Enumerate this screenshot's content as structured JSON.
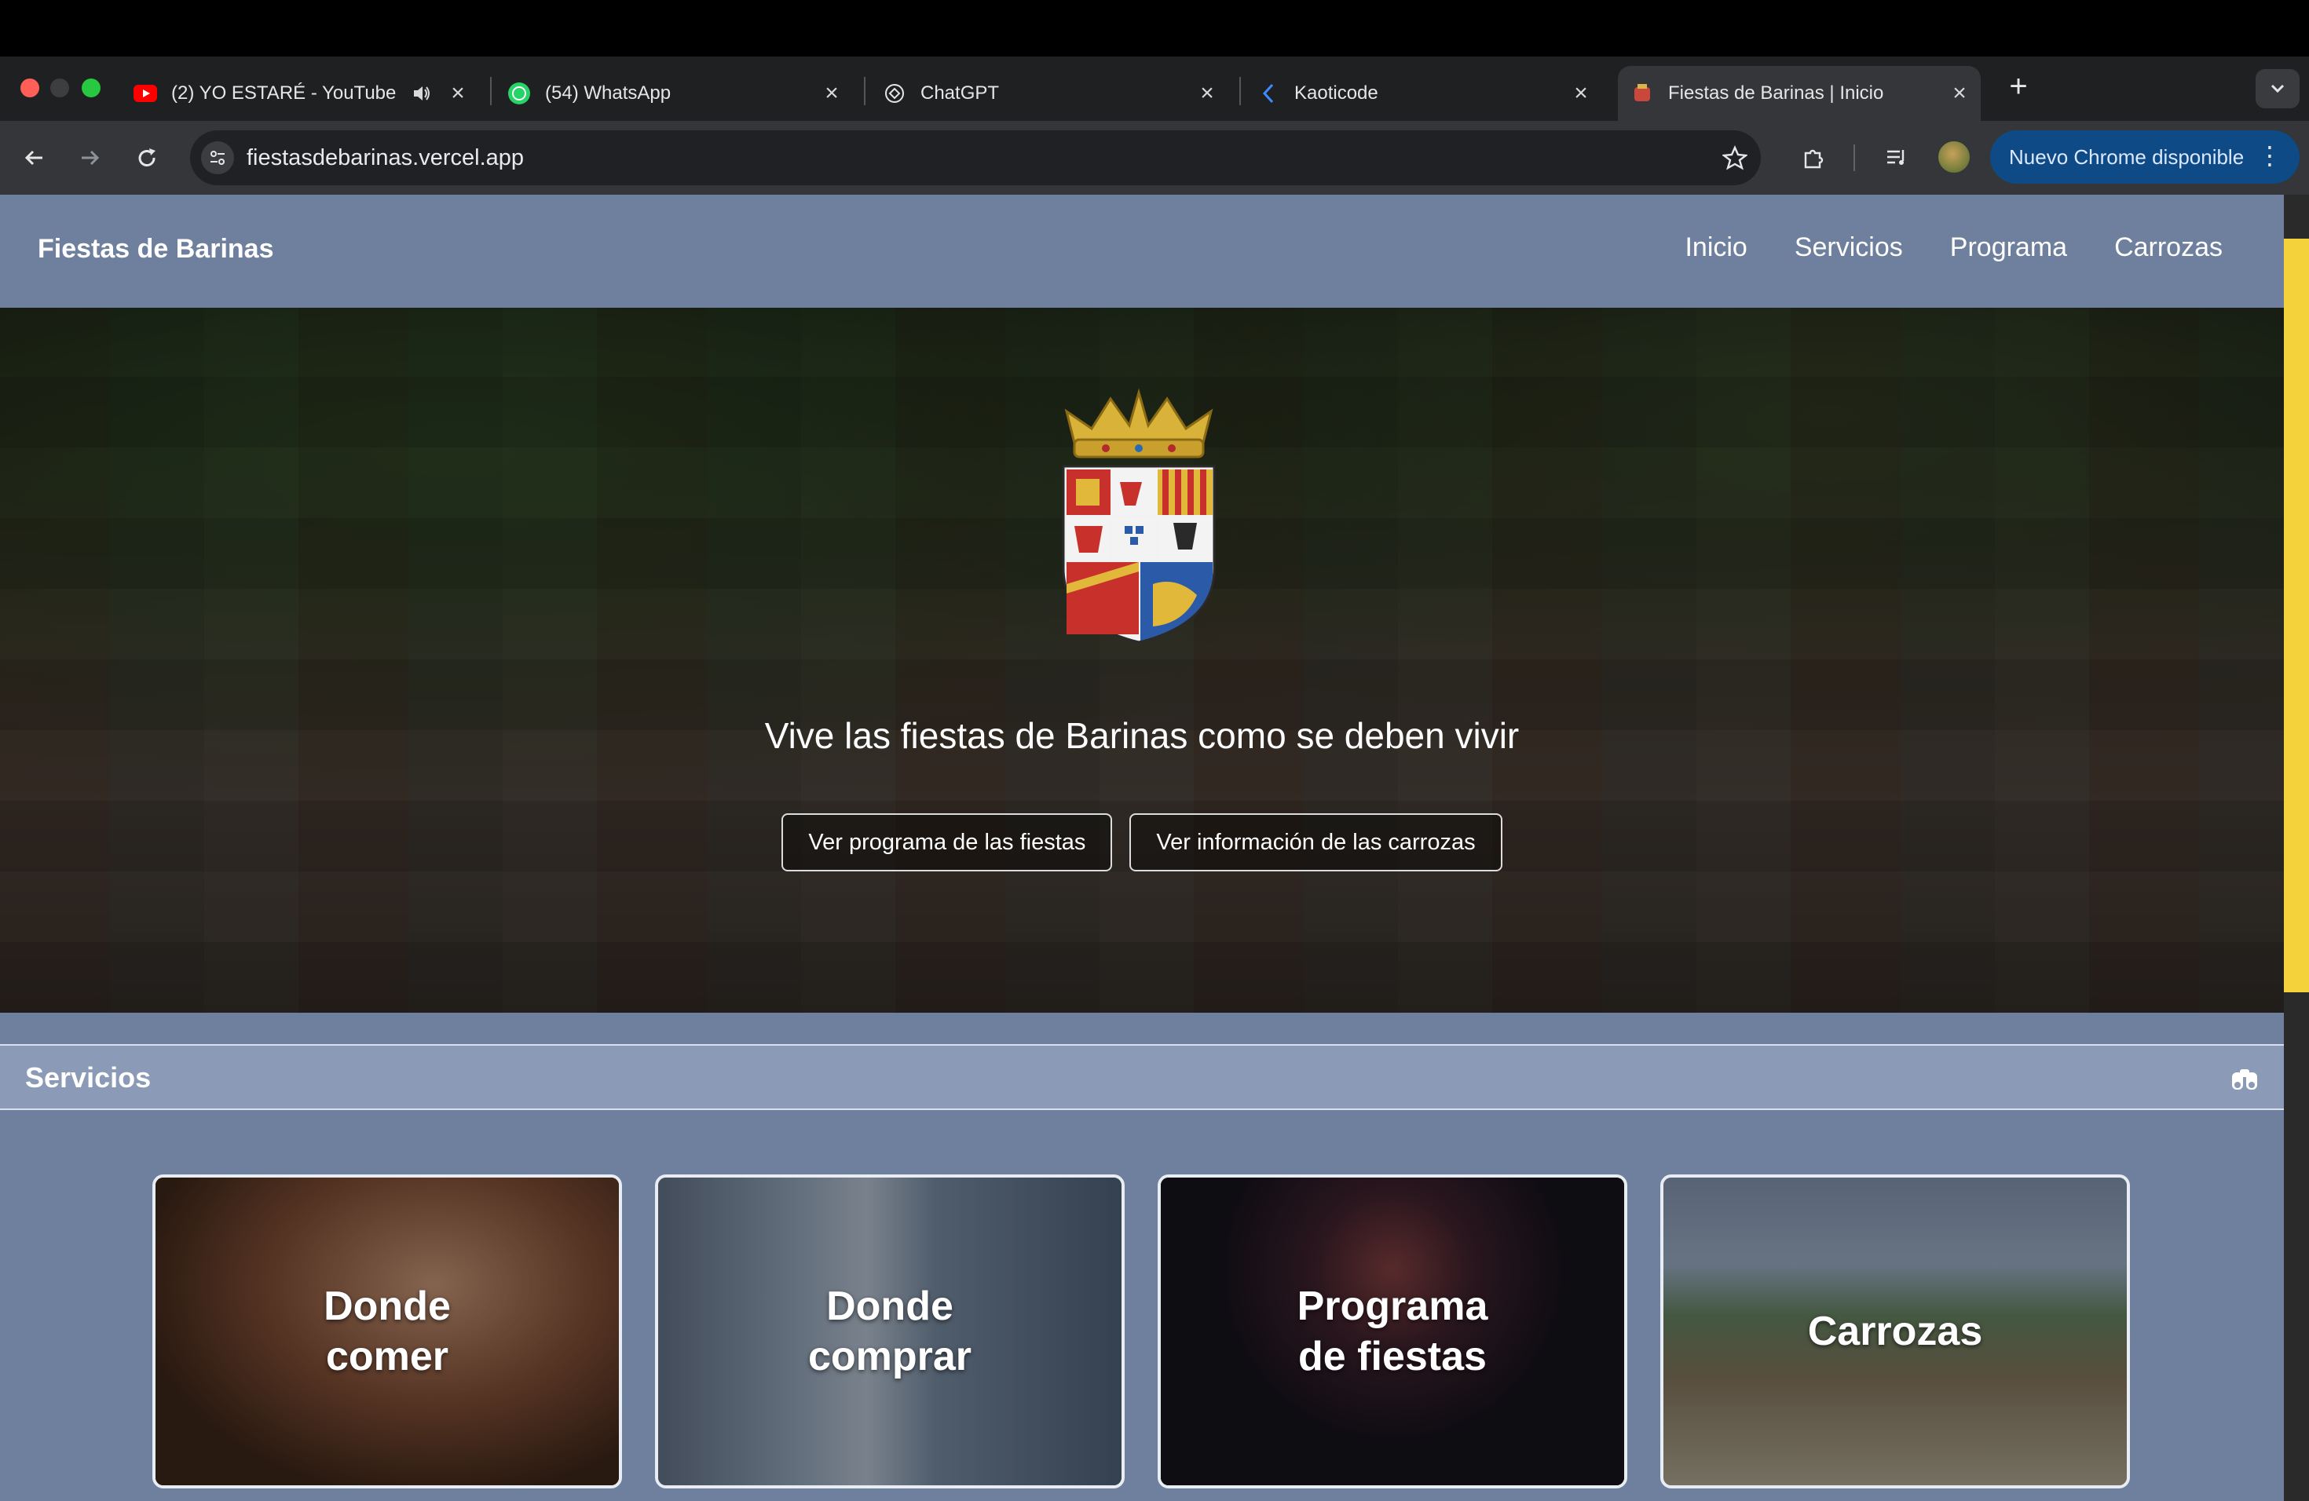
{
  "browser": {
    "tabs": [
      {
        "title": "(2) YO ESTARÉ - YouTube",
        "favicon": "youtube-icon",
        "audio": true
      },
      {
        "title": "(54) WhatsApp",
        "favicon": "whatsapp-icon"
      },
      {
        "title": "ChatGPT",
        "favicon": "chatgpt-icon"
      },
      {
        "title": "Kaoticode",
        "favicon": "kaoticode-icon"
      },
      {
        "title": "Fiestas de Barinas | Inicio",
        "favicon": "crest-favicon-icon",
        "active": true
      }
    ],
    "url": "fiestasdebarinas.vercel.app",
    "update_label": "Nuevo Chrome disponible"
  },
  "site": {
    "brand": "Fiestas de Barinas",
    "nav": [
      "Inicio",
      "Servicios",
      "Programa",
      "Carrozas"
    ],
    "hero": {
      "tagline": "Vive las fiestas de Barinas como se deben vivir",
      "btn_programa": "Ver programa de las fiestas",
      "btn_carrozas": "Ver información de las carrozas"
    },
    "services": {
      "title": "Servicios",
      "cards": [
        {
          "label": "Donde\ncomer"
        },
        {
          "label": "Donde\ncomprar"
        },
        {
          "label": "Programa\nde fiestas"
        },
        {
          "label": "Carrozas"
        }
      ]
    }
  },
  "colors": {
    "header_bg": "#6f809e",
    "services_bar_bg": "#8b9bb7",
    "scroll_thumb": "#f3d23c",
    "chrome_update_pill": "#0e4a85"
  }
}
